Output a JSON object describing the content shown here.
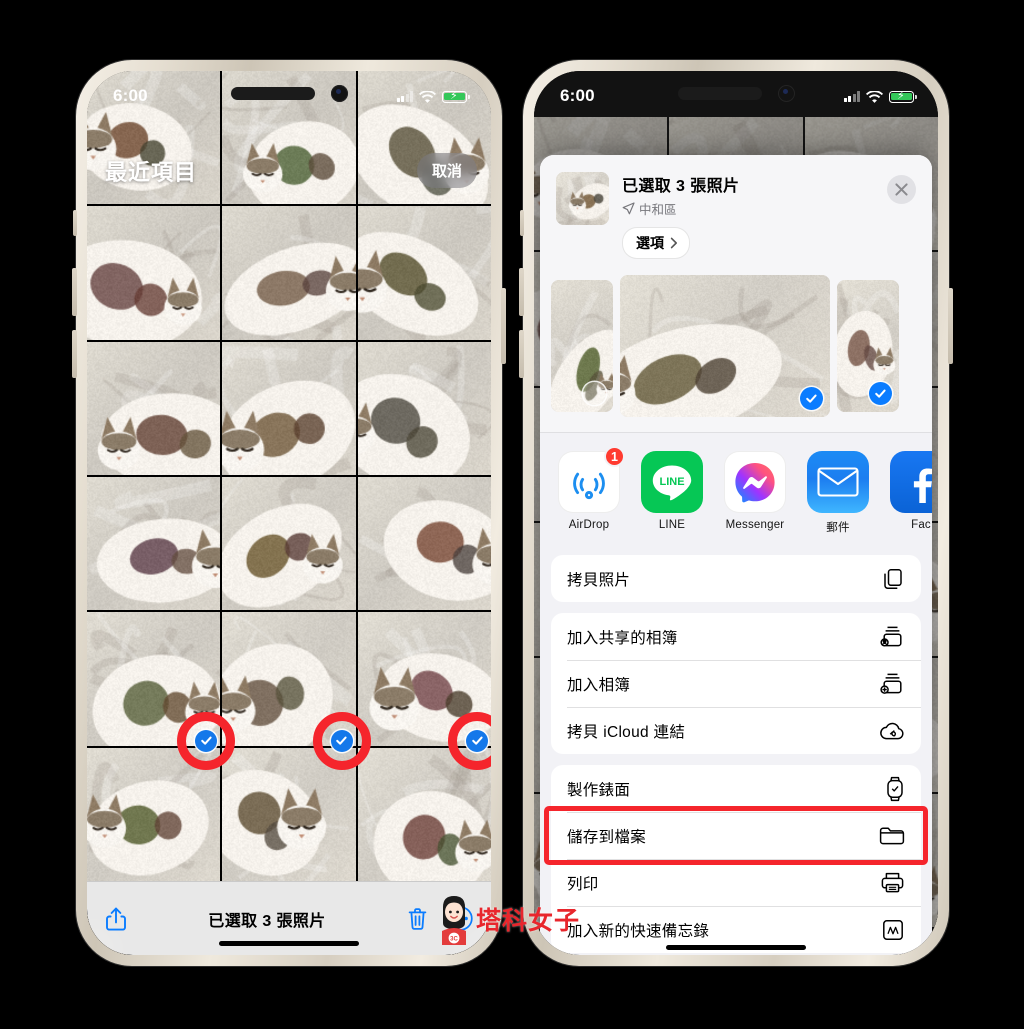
{
  "left_phone": {
    "status": {
      "time": "6:00",
      "battery_charging": true,
      "wifi": true,
      "signal_bars": 2
    },
    "album_title": "最近項目",
    "cancel_label": "取消",
    "toolbar": {
      "share_icon": "share-icon",
      "status_label": "已選取 3 張照片",
      "trash_icon": "trash-icon",
      "more_icon": "more-ellipsis-icon"
    },
    "selected_count": 3
  },
  "right_phone": {
    "status": {
      "time": "6:00",
      "battery_charging": true,
      "wifi": true,
      "signal_bars": 2
    },
    "share_sheet": {
      "title": "已選取 3 張照片",
      "subtitle": "中和區",
      "location_icon": "location-arrow-icon",
      "options_label": "選項",
      "close_icon": "close-icon",
      "previews": [
        {
          "selected": false
        },
        {
          "selected": true
        },
        {
          "selected": true
        }
      ],
      "apps": [
        {
          "name": "AirDrop",
          "label": "AirDrop",
          "icon": "airdrop-icon",
          "badge": "1"
        },
        {
          "name": "LINE",
          "label": "LINE",
          "icon": "line-icon",
          "badge": null
        },
        {
          "name": "Messenger",
          "label": "Messenger",
          "icon": "messenger-icon",
          "badge": null
        },
        {
          "name": "Mail",
          "label": "郵件",
          "icon": "mail-icon",
          "badge": null
        },
        {
          "name": "Facebook",
          "label": "Fac",
          "icon": "facebook-icon",
          "badge": null
        }
      ],
      "groups": [
        {
          "rows": [
            {
              "label": "拷貝照片",
              "icon": "copy-photos-icon",
              "highlighted": false
            }
          ]
        },
        {
          "rows": [
            {
              "label": "加入共享的相簿",
              "icon": "shared-album-icon",
              "highlighted": false
            },
            {
              "label": "加入相簿",
              "icon": "add-album-icon",
              "highlighted": false
            },
            {
              "label": "拷貝 iCloud 連結",
              "icon": "icloud-link-icon",
              "highlighted": false
            }
          ]
        },
        {
          "rows": [
            {
              "label": "製作錶面",
              "icon": "watch-face-icon",
              "highlighted": false
            },
            {
              "label": "儲存到檔案",
              "icon": "folder-icon",
              "highlighted": true
            },
            {
              "label": "列印",
              "icon": "printer-icon",
              "highlighted": false
            },
            {
              "label": "加入新的快速備忘錄",
              "icon": "quick-note-icon",
              "highlighted": false
            }
          ]
        }
      ]
    }
  },
  "watermark": {
    "text": "塔科女子",
    "mascot_badge": "3C"
  },
  "colors": {
    "accent_blue": "#0a7cff",
    "highlight_red": "#f5252c",
    "checkmark_blue": "#1478ea",
    "sheet_bg": "#f2f2f6",
    "battery_green": "#34c759"
  }
}
